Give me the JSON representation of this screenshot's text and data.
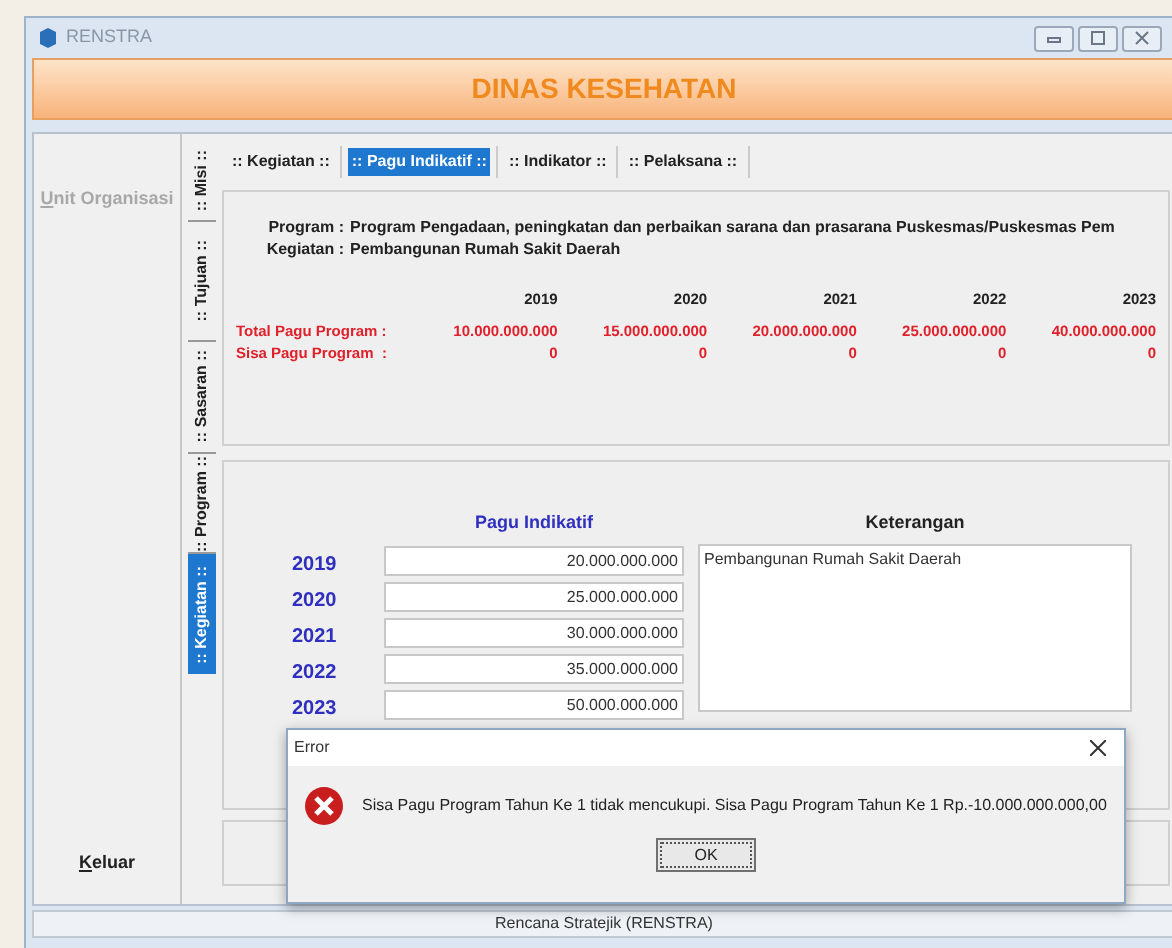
{
  "window": {
    "title": "RENSTRA"
  },
  "header": {
    "title": "DINAS KESEHATAN"
  },
  "sidebar": {
    "items": [
      {
        "label": "Unit Organisasi",
        "disabled": true
      },
      {
        "label": "Keluar",
        "disabled": false
      }
    ]
  },
  "vertical_tabs": [
    {
      "label": ":: Misi ::",
      "selected": false
    },
    {
      "label": ":: Tujuan ::",
      "selected": false
    },
    {
      "label": ":: Sasaran ::",
      "selected": false
    },
    {
      "label": ":: Program ::",
      "selected": false
    },
    {
      "label": ":: Kegiatan ::",
      "selected": true
    }
  ],
  "tabs": [
    {
      "label": ":: Kegiatan ::",
      "selected": false
    },
    {
      "label": ":: Pagu Indikatif ::",
      "selected": true
    },
    {
      "label": ":: Indikator ::",
      "selected": false
    },
    {
      "label": ":: Pelaksana ::",
      "selected": false
    }
  ],
  "summary": {
    "program_label": "Program :",
    "program": "Program Pengadaan, peningkatan dan perbaikan sarana dan prasarana Puskesmas/Puskesmas Pem",
    "kegiatan_label": "Kegiatan :",
    "kegiatan": "Pembangunan Rumah Sakit Daerah",
    "years": [
      "2019",
      "2020",
      "2021",
      "2022",
      "2023"
    ],
    "rows": [
      {
        "label": "Total Pagu Program :",
        "values": [
          "10.000.000.000",
          "15.000.000.000",
          "20.000.000.000",
          "25.000.000.000",
          "40.000.000.000"
        ]
      },
      {
        "label": "Sisa Pagu Program  :",
        "values": [
          "0",
          "0",
          "0",
          "0",
          "0"
        ]
      }
    ]
  },
  "pagu": {
    "heading": "Pagu Indikatif",
    "keterangan_heading": "Keterangan",
    "keterangan": "Pembangunan Rumah Sakit Daerah",
    "rows": [
      {
        "year": "2019",
        "value": "20.000.000.000"
      },
      {
        "year": "2020",
        "value": "25.000.000.000"
      },
      {
        "year": "2021",
        "value": "30.000.000.000"
      },
      {
        "year": "2022",
        "value": "35.000.000.000"
      },
      {
        "year": "2023",
        "value": "50.000.000.000"
      }
    ]
  },
  "dialog": {
    "title": "Error",
    "message": "Sisa Pagu Program Tahun Ke 1 tidak mencukupi. Sisa Pagu Program Tahun Ke 1 Rp.-10.000.000.000,00",
    "button": "OK"
  },
  "status_bar": "Rencana Stratejik (RENSTRA)"
}
